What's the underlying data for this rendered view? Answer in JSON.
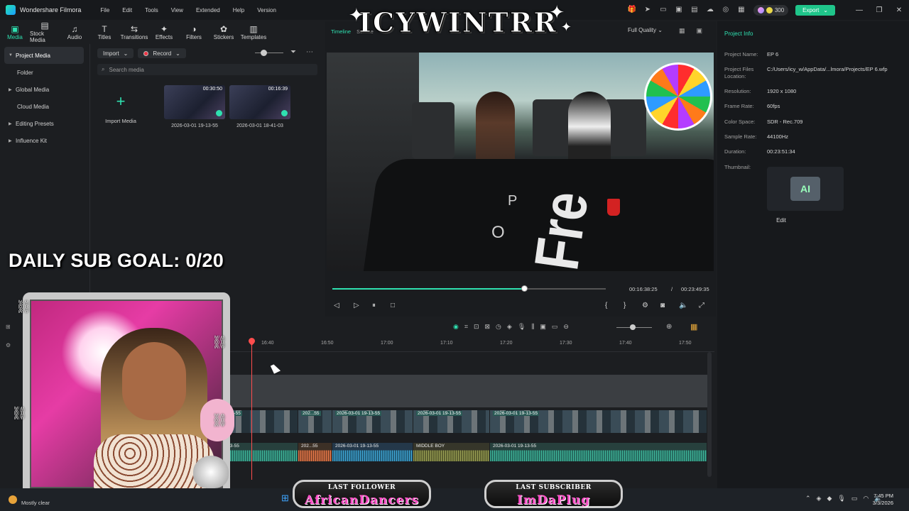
{
  "app": {
    "name": "Wondershare Filmora",
    "menu": [
      "File",
      "Edit",
      "Tools",
      "View",
      "Extended",
      "Help",
      "Version"
    ],
    "credits": "300",
    "export_label": "Export"
  },
  "overlay": {
    "logo_text": "ICYWINTRR",
    "sub_goal": "DAILY SUB GOAL: 0/20",
    "last_follower_label": "LAST FOLLOWER",
    "last_follower": "AfricanDancers",
    "last_subscriber_label": "LAST SUBSCRIBER",
    "last_subscriber": "ImDaPlug"
  },
  "toolbar": {
    "tools": [
      {
        "label": "Media",
        "icon": "media-icon"
      },
      {
        "label": "Stock Media",
        "icon": "stock-media-icon"
      },
      {
        "label": "Audio",
        "icon": "audio-icon"
      },
      {
        "label": "Titles",
        "icon": "titles-icon"
      },
      {
        "label": "Transitions",
        "icon": "transitions-icon"
      },
      {
        "label": "Effects",
        "icon": "effects-icon"
      },
      {
        "label": "Filters",
        "icon": "filters-icon"
      },
      {
        "label": "Stickers",
        "icon": "stickers-icon"
      },
      {
        "label": "Templates",
        "icon": "templates-icon"
      }
    ]
  },
  "media_nav": {
    "items": [
      {
        "label": "Project Media"
      },
      {
        "label": "Folder"
      },
      {
        "label": "Global Media"
      },
      {
        "label": "Cloud Media"
      },
      {
        "label": "Editing Presets"
      },
      {
        "label": "Influence Kit"
      }
    ]
  },
  "media": {
    "import_label": "Import",
    "record_label": "Record",
    "search_placeholder": "Search media",
    "import_media_label": "Import Media",
    "clips": [
      {
        "name": "2026-03-01 19-13-55",
        "duration": "00:30:50"
      },
      {
        "name": "2026-03-01 18-41-03",
        "duration": "00:16:39"
      }
    ]
  },
  "preview": {
    "tab_timeline": "Timeline",
    "tab_source": "Source",
    "quality": "Full Quality",
    "current_time": "00:16:38:25",
    "separator": "/",
    "total_time": "00:23:49:35",
    "progress_fraction": 0.7
  },
  "project_info": {
    "title": "Project Info",
    "rows": [
      {
        "label": "Project Name:",
        "value": "EP 6"
      },
      {
        "label": "Project Files Location:",
        "value": "C:/Users/icy_w/AppData/...lmora/Projects/EP 6.wfp"
      },
      {
        "label": "Resolution:",
        "value": "1920 x 1080"
      },
      {
        "label": "Frame Rate:",
        "value": "60fps"
      },
      {
        "label": "Color Space:",
        "value": "SDR - Rec.709"
      },
      {
        "label": "Sample Rate:",
        "value": "44100Hz"
      },
      {
        "label": "Duration:",
        "value": "00:23:51:34"
      },
      {
        "label": "Thumbnail:",
        "value": ""
      }
    ],
    "edit_label": "Edit"
  },
  "timeline": {
    "ruler_ticks": [
      "16:40",
      "16:50",
      "17:00",
      "17:10",
      "17:20",
      "17:30",
      "17:40",
      "17:50"
    ],
    "video_clips": [
      ":3-55",
      "202...55",
      "2026-03-01 19-13-55",
      "2026-03-01 19-13-55",
      "2026-03-01 19-13-55"
    ],
    "audio_clips": [
      ":3-55",
      "202...55",
      "2026-03-01 19-13-55",
      "MIDDLE BOY",
      "2026-03-01 19-13-55"
    ]
  },
  "taskbar": {
    "weather": "Mostly clear",
    "time": "7:45 PM",
    "date": "3/3/2026"
  }
}
